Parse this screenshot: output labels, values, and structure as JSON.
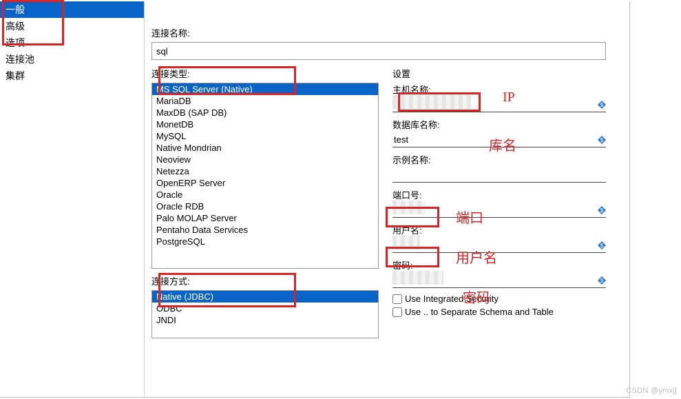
{
  "sidebar": {
    "items": [
      {
        "label": "一般",
        "selected": true
      },
      {
        "label": "高级",
        "selected": false
      },
      {
        "label": "选项",
        "selected": false
      },
      {
        "label": "连接池",
        "selected": false
      },
      {
        "label": "集群",
        "selected": false
      }
    ]
  },
  "connection_name": {
    "label": "连接名称:",
    "value": "sql"
  },
  "connection_type": {
    "label": "连接类型:",
    "items": [
      {
        "label": "MS SQL Server (Native)",
        "selected": true
      },
      {
        "label": "MariaDB"
      },
      {
        "label": "MaxDB (SAP DB)"
      },
      {
        "label": "MonetDB"
      },
      {
        "label": "MySQL"
      },
      {
        "label": "Native Mondrian"
      },
      {
        "label": "Neoview"
      },
      {
        "label": "Netezza"
      },
      {
        "label": "OpenERP Server"
      },
      {
        "label": "Oracle"
      },
      {
        "label": "Oracle RDB"
      },
      {
        "label": "Palo MOLAP Server"
      },
      {
        "label": "Pentaho Data Services"
      },
      {
        "label": "PostgreSQL"
      }
    ]
  },
  "connection_method": {
    "label": "连接方式:",
    "items": [
      {
        "label": "Native (JDBC)",
        "selected": true
      },
      {
        "label": "ODBC"
      },
      {
        "label": "JNDI"
      }
    ]
  },
  "settings": {
    "title": "设置",
    "host": {
      "label": "主机名称:",
      "value": ""
    },
    "db": {
      "label": "数据库名称:",
      "value": "test"
    },
    "instance": {
      "label": "示例名称:",
      "value": ""
    },
    "port": {
      "label": "端口号:",
      "value": ""
    },
    "user": {
      "label": "用户名:",
      "value": ""
    },
    "password": {
      "label": "密码:",
      "value": ""
    },
    "cb1": "Use Integrated Security",
    "cb2": "Use .. to Separate Schema and Table"
  },
  "annotations": {
    "ip": "IP",
    "dbname": "库名",
    "port": "端口",
    "user": "用户名",
    "pwd": "密码"
  },
  "watermark": "CSDN @ymxjj"
}
